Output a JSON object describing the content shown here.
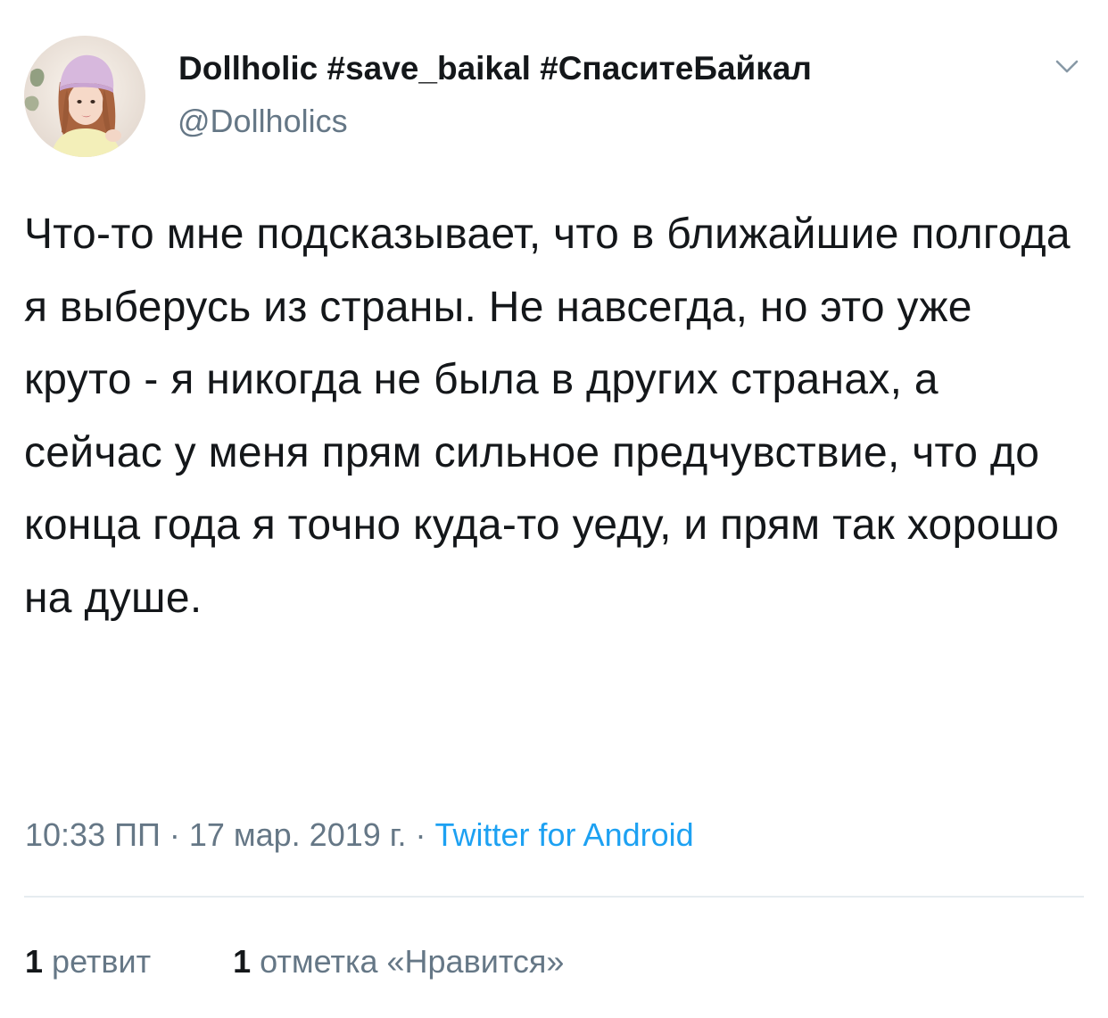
{
  "user": {
    "display_name": "Dollholic #save_baikal #СпаситеБайкал",
    "handle": "@Dollholics"
  },
  "menu": {
    "icon": "chevron-down-icon"
  },
  "tweet": {
    "text": "Что-то мне подсказывает, что в ближайшие полгода я выберусь из страны. Не навсегда, но это уже круто - я никогда не была в других странах, а сейчас у меня прям сильное предчувствие, что до конца года я точно куда-то уеду, и прям так хорошо на душе."
  },
  "meta": {
    "time": "10:33 ПП",
    "separator_1": " · ",
    "date": "17 мар. 2019 г.",
    "separator_2": " · ",
    "source": "Twitter for Android"
  },
  "stats": {
    "retweets_count": "1",
    "retweets_label": "ретвит",
    "likes_count": "1",
    "likes_label": "отметка «Нравится»"
  },
  "colors": {
    "text_primary": "#14171a",
    "text_secondary": "#657786",
    "link": "#1da1f2",
    "divider": "#e6ecf0"
  }
}
